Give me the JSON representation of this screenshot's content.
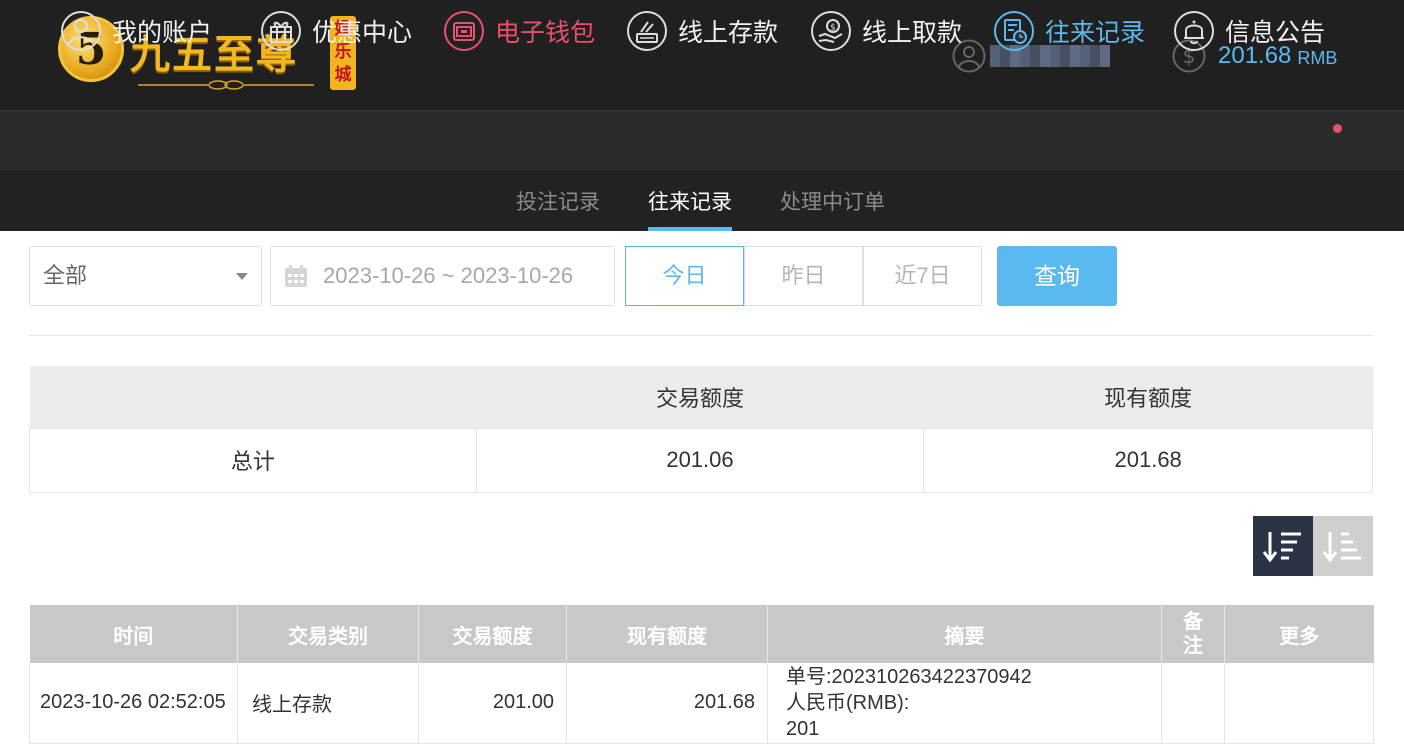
{
  "header": {
    "logo": {
      "badge": "5",
      "name": "九五至尊",
      "tag": [
        "娱",
        "乐",
        "城"
      ]
    },
    "user": {
      "icon": "user-circle-icon",
      "name_masked": true
    },
    "balance": {
      "icon": "dollar-coin-icon",
      "amount": "201.68",
      "unit": "RMB"
    }
  },
  "nav": {
    "items": [
      {
        "label": "我的账户",
        "icon": "user-circle-icon"
      },
      {
        "label": "优惠中心",
        "icon": "gift-icon"
      },
      {
        "label": "电子钱包",
        "icon": "wallet-icon",
        "color": "#e9506a"
      },
      {
        "label": "线上存款",
        "icon": "deposit-icon"
      },
      {
        "label": "线上取款",
        "icon": "withdraw-icon"
      },
      {
        "label": "往来记录",
        "icon": "records-icon",
        "color": "#5ab9ef",
        "active": true
      },
      {
        "label": "信息公告",
        "icon": "bell-icon",
        "has_badge": true
      }
    ]
  },
  "subnav": {
    "items": [
      {
        "label": "投注记录"
      },
      {
        "label": "往来记录",
        "active": true
      },
      {
        "label": "处理中订单"
      }
    ]
  },
  "filters": {
    "type_select": "全部",
    "date_range": "2023-10-26 ~ 2023-10-26",
    "quick": [
      "今日",
      "昨日",
      "近7日"
    ],
    "quick_active": "今日",
    "search_label": "查询"
  },
  "summary": {
    "headers": [
      "",
      "交易额度",
      "现有额度"
    ],
    "row": {
      "label": "总计",
      "amount": "201.06",
      "balance": "201.68"
    }
  },
  "sort": {
    "desc_icon": "sort-desc-icon",
    "asc_icon": "sort-asc-icon",
    "active": "desc"
  },
  "details": {
    "headers": [
      "时间",
      "交易类别",
      "交易额度",
      "现有额度",
      "摘要",
      "备注",
      "更多"
    ],
    "rows": [
      {
        "time": "2023-10-26 02:52:05",
        "type": "线上存款",
        "amount": "201.00",
        "balance": "201.68",
        "summary": [
          "单号:202310263422370942",
          "人民币(RMB):",
          "201"
        ],
        "remark": "",
        "more": ""
      }
    ]
  },
  "colors": {
    "accent": "#5ab9ef",
    "highlight": "#e9506a",
    "header_bg": "#202020",
    "nav_bg": "#2b2b2b"
  }
}
